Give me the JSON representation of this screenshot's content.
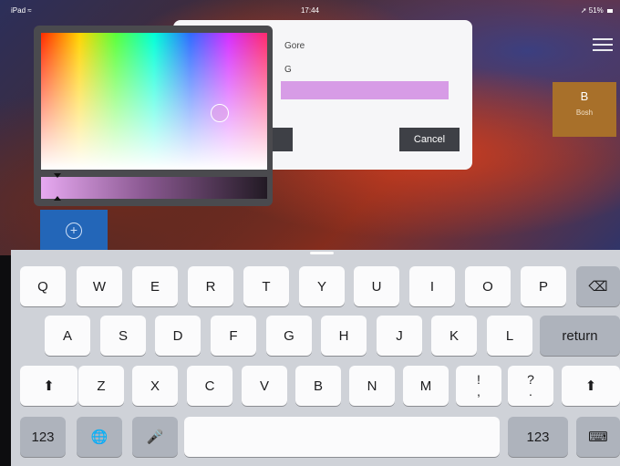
{
  "status_bar": {
    "carrier": "iPad",
    "wifi_icon": "wifi-icon",
    "time": "17:44",
    "location_icon": "location-arrow-icon",
    "battery": "51%"
  },
  "app": {
    "b_button": {
      "letter": "B",
      "label": "Bosh",
      "color": "#a8702a"
    },
    "add_tile": {
      "icon": "add-circle-icon",
      "color": "#2366b8"
    },
    "menu_icon": "hamburger-menu-icon"
  },
  "dialog": {
    "title": "Gore",
    "field_label": "G",
    "swatch_color": "#d79ce6",
    "cancel_label": "Cancel"
  },
  "color_picker": {
    "selected_color": "#d79ce6"
  },
  "keyboard": {
    "row1": [
      "Q",
      "W",
      "E",
      "R",
      "T",
      "Y",
      "U",
      "I",
      "O",
      "P"
    ],
    "row2": [
      "A",
      "S",
      "D",
      "F",
      "G",
      "H",
      "J",
      "K",
      "L"
    ],
    "row3": [
      "Z",
      "X",
      "C",
      "V",
      "B",
      "N",
      "M"
    ],
    "exclaim_top": "!",
    "exclaim_bottom": ",",
    "question_top": "?",
    "question_bottom": ".",
    "return_label": "return",
    "numbers_label": "123",
    "backspace_icon": "backspace-icon",
    "shift_icon": "shift-icon",
    "globe_icon": "globe-icon",
    "mic_icon": "microphone-icon",
    "hide_keyboard_icon": "hide-keyboard-icon"
  }
}
